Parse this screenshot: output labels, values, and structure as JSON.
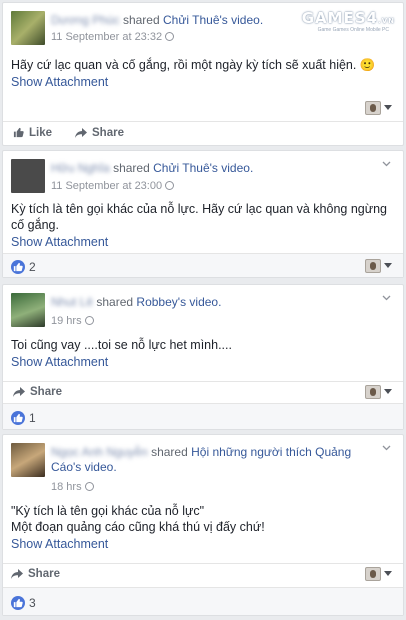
{
  "watermark": {
    "brand": "GAMES",
    "mid": "4",
    "tld": ".VN",
    "tag": "Game Games Online Mobile PC"
  },
  "posts": [
    {
      "author": "Dương Phúc",
      "shared_text": "shared",
      "target": "Chửi Thuê",
      "target_suffix": "'s video.",
      "time": "11 September at 23:32",
      "message": "Hãy cứ lạc quan và cố gắng, rồi một ngày kỳ tích sẽ xuất hiện. 🙂",
      "attachment": "Show Attachment",
      "like_label": "Like",
      "share_label": "Share"
    },
    {
      "author": "Hữu Nghĩa",
      "shared_text": "shared",
      "target": "Chửi Thuê",
      "target_suffix": "'s video.",
      "time": "11 September at 23:00",
      "message": "Kỳ tích là tên gọi khác của nỗ lực. Hãy cứ lạc quan và không ngừng cố gắng.",
      "attachment": "Show Attachment",
      "reactions": "2"
    },
    {
      "author": "Nhut Lê",
      "shared_text": "shared",
      "target": "Robbey",
      "target_suffix": "'s video.",
      "time": "19 hrs",
      "message": "Toi cũng vay ....toi se nỗ lực het mình....",
      "attachment": "Show Attachment",
      "share_label": "Share",
      "reactions": "1"
    },
    {
      "author": "Ngọc Anh Nguyễn",
      "shared_text": "shared",
      "target": "Hội những người thích Quảng Cáo",
      "target_suffix": "'s video.",
      "time": "18 hrs",
      "message_line1": "\"Kỳ tích là tên gọi khác của nỗ lực\"",
      "message_line2": "Một đoạn quảng cáo cũng khá thú vị đấy chứ!",
      "attachment": "Show Attachment",
      "share_label": "Share",
      "reactions": "3"
    }
  ],
  "colors": {
    "link": "#365899",
    "like_blue": "#4a74d9",
    "bg": "#e9ebee"
  }
}
